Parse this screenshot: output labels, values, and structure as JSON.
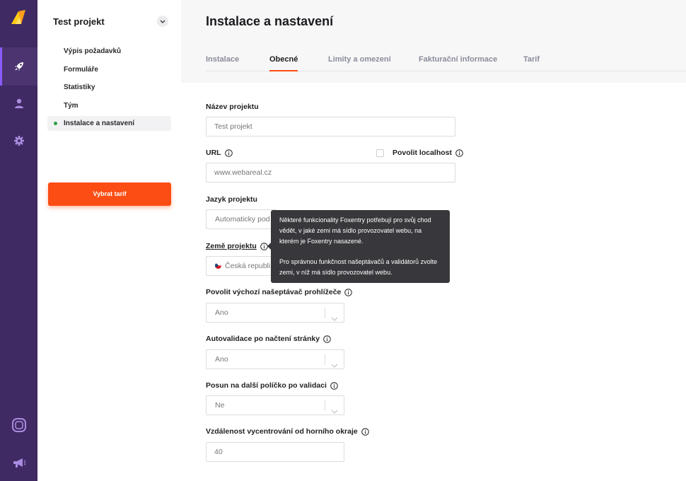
{
  "colors": {
    "rail": "#3f2a63",
    "accent": "#fc4d14",
    "active_dot": "#2ea043",
    "tooltip_bg": "#38383c"
  },
  "rail": {
    "logo": "foxentry-logo",
    "items": [
      {
        "icon": "rocket-icon",
        "active": true
      },
      {
        "icon": "user-icon",
        "active": false
      },
      {
        "icon": "gear-icon",
        "active": false
      }
    ],
    "bottom": [
      {
        "icon": "lifebuoy-icon"
      },
      {
        "icon": "megaphone-icon"
      }
    ]
  },
  "sidebar": {
    "project_name": "Test projekt",
    "toggle_icon": "chevron-down-icon",
    "items": [
      {
        "label": "Výpis požadavků",
        "active": false
      },
      {
        "label": "Formuláře",
        "active": false
      },
      {
        "label": "Statistiky",
        "active": false
      },
      {
        "label": "Tým",
        "active": false
      },
      {
        "label": "Instalace a nastavení",
        "active": true
      }
    ],
    "cta_label": "Vybrat tarif"
  },
  "main": {
    "title": "Instalace a nastavení",
    "tabs": [
      {
        "label": "Instalace",
        "active": false
      },
      {
        "label": "Obecné",
        "active": true
      },
      {
        "label": "Limity a omezení",
        "active": false
      },
      {
        "label": "Fakturační informace",
        "active": false
      },
      {
        "label": "Tarif",
        "active": false
      }
    ]
  },
  "form": {
    "project_name": {
      "label": "Název projektu",
      "placeholder": "Test projekt"
    },
    "url": {
      "label": "URL",
      "placeholder": "www.webareal.cz"
    },
    "allow_localhost": {
      "label": "Povolit localhost",
      "checked": false
    },
    "language": {
      "label": "Jazyk projektu",
      "value": "Automaticky pod"
    },
    "country": {
      "label": "Země projektu",
      "value": "Česká republik"
    },
    "browser_whisperer": {
      "label": "Povolit výchozí našeptávač prohlížeče",
      "value": "Ano"
    },
    "autovalidate": {
      "label": "Autovalidace po načtení stránky",
      "value": "Ano"
    },
    "next_field": {
      "label": "Posun na další políčko po validaci",
      "value": "Ne"
    },
    "centering_offset": {
      "label": "Vzdálenost vycentrování od horního okraje",
      "value": "40"
    }
  },
  "tooltip": {
    "paragraph1": "Některé funkcionality Foxentry potřebují pro svůj chod vědět, v jaké zemi má sídlo provozovatel webu, na kterém je Foxentry nasazené.",
    "paragraph2": "Pro správnou funkčnost našeptávačů a validátorů zvolte zemi, v níž má sídlo provozovatel webu."
  }
}
